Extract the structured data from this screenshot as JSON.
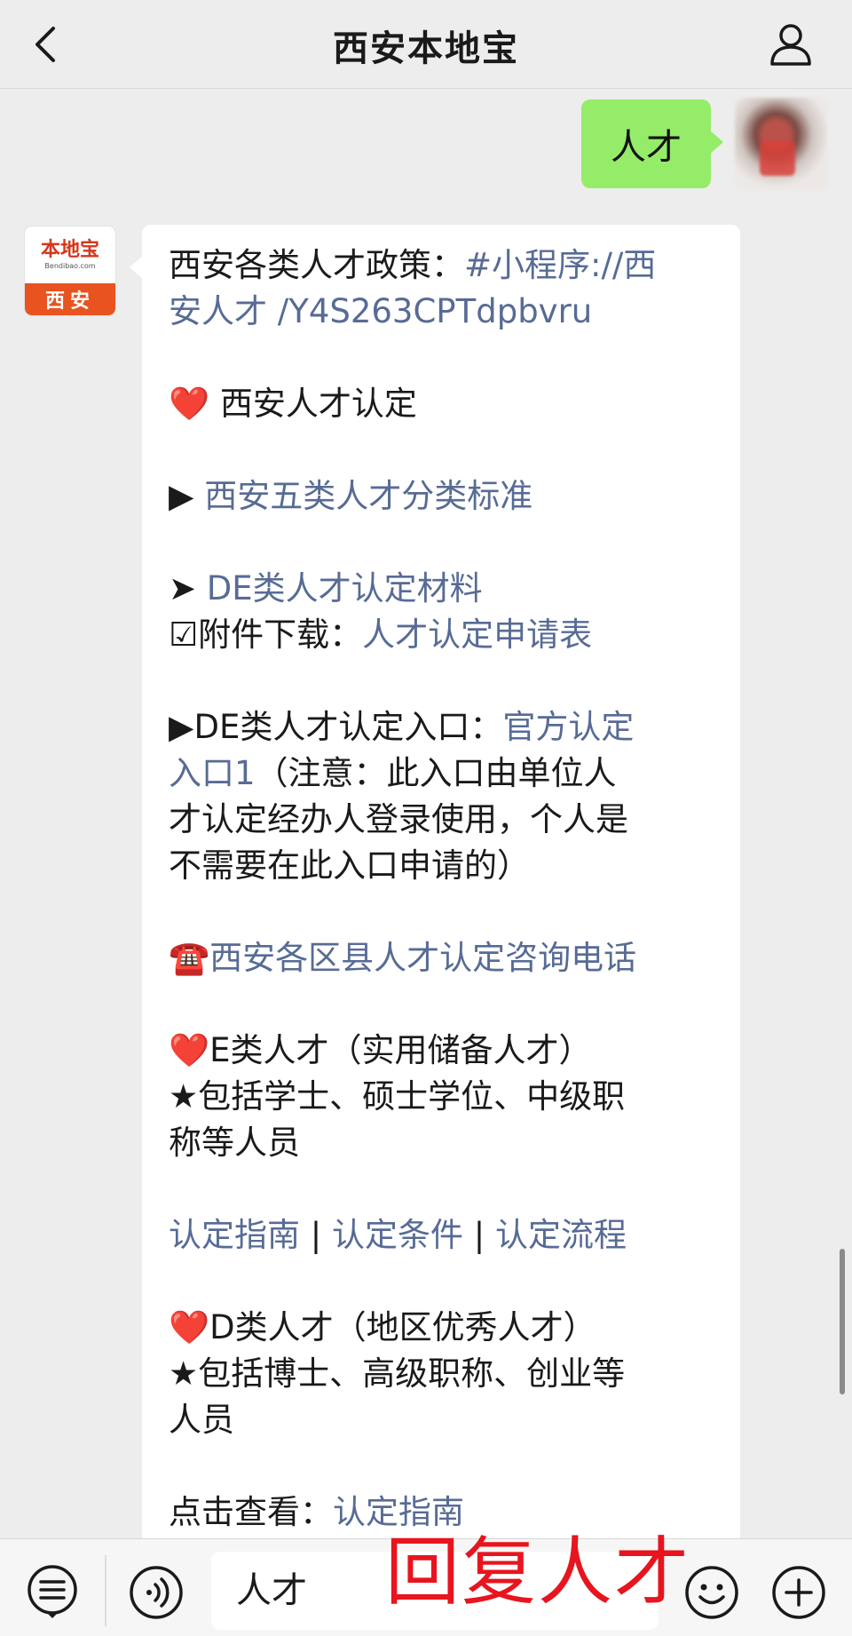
{
  "header": {
    "title": "西安本地宝",
    "back_icon": "chevron-left-icon",
    "profile_icon": "person-icon"
  },
  "outgoing": {
    "text": "人才"
  },
  "bot_avatar": {
    "logo_text": "本地宝",
    "logo_sub": "Bendibao.com",
    "logo_city": "西安"
  },
  "message": {
    "l01a": "西安各类人才政策：",
    "l01b": "#小程序://西",
    "l02": "安人才 /Y4S263CPTdpbvru",
    "l03_icon": "❤️",
    "l03": " 西安人才认定",
    "l04_icon": "▶ ",
    "l04": "西安五类人才分类标准",
    "l05_icon": "➤ ",
    "l05": "DE类人才认定材料",
    "l06a": "☑附件下载：",
    "l06b": "人才认定申请表",
    "l07a": "▶DE类人才认定入口：",
    "l07b": "官方认定",
    "l08a": "入口1",
    "l08b": "（注意：此入口由单位人",
    "l09": "才认定经办人登录使用，个人是",
    "l10": "不需要在此入口申请的）",
    "l11_icon": "☎️",
    "l11": "西安各区县人才认定咨询电话",
    "l12_icon": "❤️",
    "l12": "E类人才（实用储备人才）",
    "l13": "★包括学士、硕士学位、中级职",
    "l14": "称等人员",
    "l15a": "认定指南",
    "sep": " | ",
    "l15b": "认定条件",
    "l15c": "认定流程",
    "l16_icon": "❤️",
    "l16": "D类人才（地区优秀人才）",
    "l17": "★包括博士、高级职称、创业等",
    "l18": "人员",
    "l19a": "点击查看：",
    "l19b": "认定指南"
  },
  "bottom": {
    "menu_icon": "menu-list-icon",
    "voice_icon": "voice-icon",
    "input_value": "人才",
    "emoji_icon": "emoji-icon",
    "plus_icon": "plus-icon"
  },
  "overlay_text": "回复人才"
}
